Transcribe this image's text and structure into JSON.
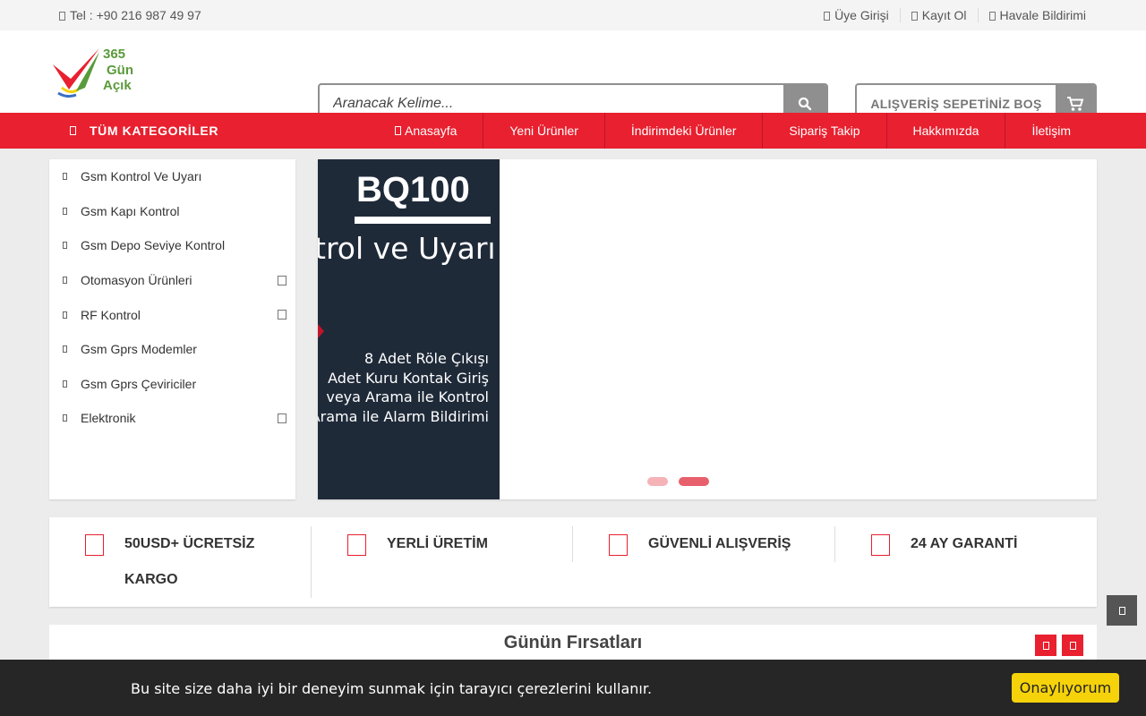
{
  "topbar": {
    "phone": "Tel : +90 216 987 49 97",
    "links": [
      "Üye Girişi",
      "Kayıt Ol",
      "Havale Bildirimi"
    ]
  },
  "logo": {
    "number": "365",
    "line1": "Gün",
    "line2": "Açık"
  },
  "search": {
    "placeholder": "Aranacak Kelime..."
  },
  "cart": {
    "label": "ALIŞVERİŞ SEPETİNİZ BOŞ"
  },
  "nav": {
    "categories": "TÜM KATEGORİLER",
    "items": [
      "Anasayfa",
      "Yeni Ürünler",
      "İndirimdeki Ürünler",
      "Sipariş Takip",
      "Hakkımızda",
      "İletişim"
    ]
  },
  "sidebar": {
    "items": [
      {
        "label": "Gsm Kontrol Ve Uyarı",
        "has_sub": false
      },
      {
        "label": "Gsm Kapı Kontrol",
        "has_sub": false
      },
      {
        "label": "Gsm Depo Seviye Kontrol",
        "has_sub": false
      },
      {
        "label": "Otomasyon Ürünleri",
        "has_sub": true
      },
      {
        "label": "RF Kontrol",
        "has_sub": true
      },
      {
        "label": "Gsm Gprs Modemler",
        "has_sub": false
      },
      {
        "label": "Gsm Gprs Çeviriciler",
        "has_sub": false
      },
      {
        "label": "Elektronik",
        "has_sub": true
      }
    ]
  },
  "slider": {
    "title": "BQ100",
    "subtitle": "trol ve Uyarı",
    "lines": [
      "8 Adet Röle Çıkışı",
      "Adet Kuru Kontak Giriş",
      "veya Arama ile Kontrol",
      "Arama ile Alarm Bildirimi"
    ],
    "slide_count": 2,
    "active_slide": 2
  },
  "features": [
    "50USD+ ÜCRETSİZ KARGO",
    "YERLİ ÜRETİM",
    "GÜVENLİ ALIŞVERİŞ",
    "24 AY GARANTİ"
  ],
  "deals": {
    "title": "Günün Fırsatları"
  },
  "cookie": {
    "message": "Bu site size daha iyi bir deneyim sunmak için tarayıcı çerezlerini kullanır.",
    "button": "Onaylıyorum"
  },
  "colors": {
    "brand_red": "#e8202f",
    "cookie_button": "#f5d20a",
    "slide_bg": "#1f2a39",
    "logo_green": "#5a9a3a"
  }
}
